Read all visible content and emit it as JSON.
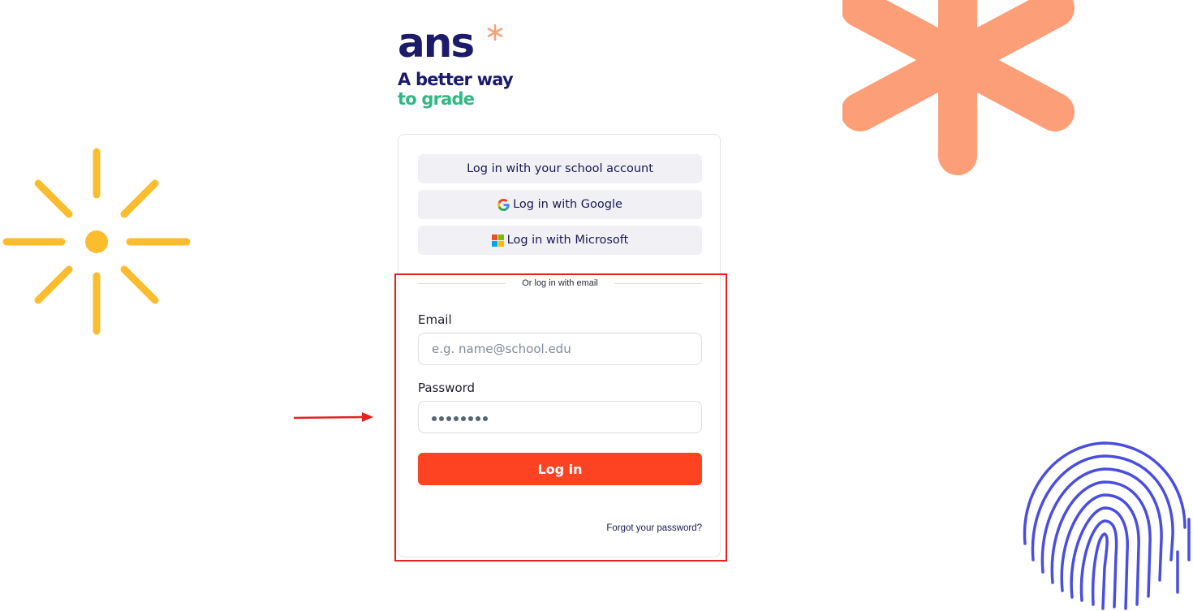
{
  "brand": {
    "logo_text": "ans",
    "tagline_line1": "A better way",
    "tagline_line2": "to grade",
    "colors": {
      "navy": "#1b1a6b",
      "green": "#2fb784",
      "accent": "#f7a27a"
    }
  },
  "sso": {
    "school_label": "Log in with your school account",
    "google_label": "Log in with Google",
    "microsoft_label": "Log in with Microsoft"
  },
  "divider_text": "Or log in with email",
  "form": {
    "email_label": "Email",
    "email_placeholder": "e.g. name@school.edu",
    "email_value": "",
    "password_label": "Password",
    "password_masked": "••••••••",
    "login_label": "Log in",
    "forgot_label": "Forgot your password?",
    "login_color": "#fd4322"
  },
  "annotation": {
    "highlight_color": "#e4221f"
  },
  "decorations": {
    "sun_color": "#fbbd2e",
    "asterisk_color": "#fc9f78",
    "fingerprint_color": "#4a4ee0"
  }
}
